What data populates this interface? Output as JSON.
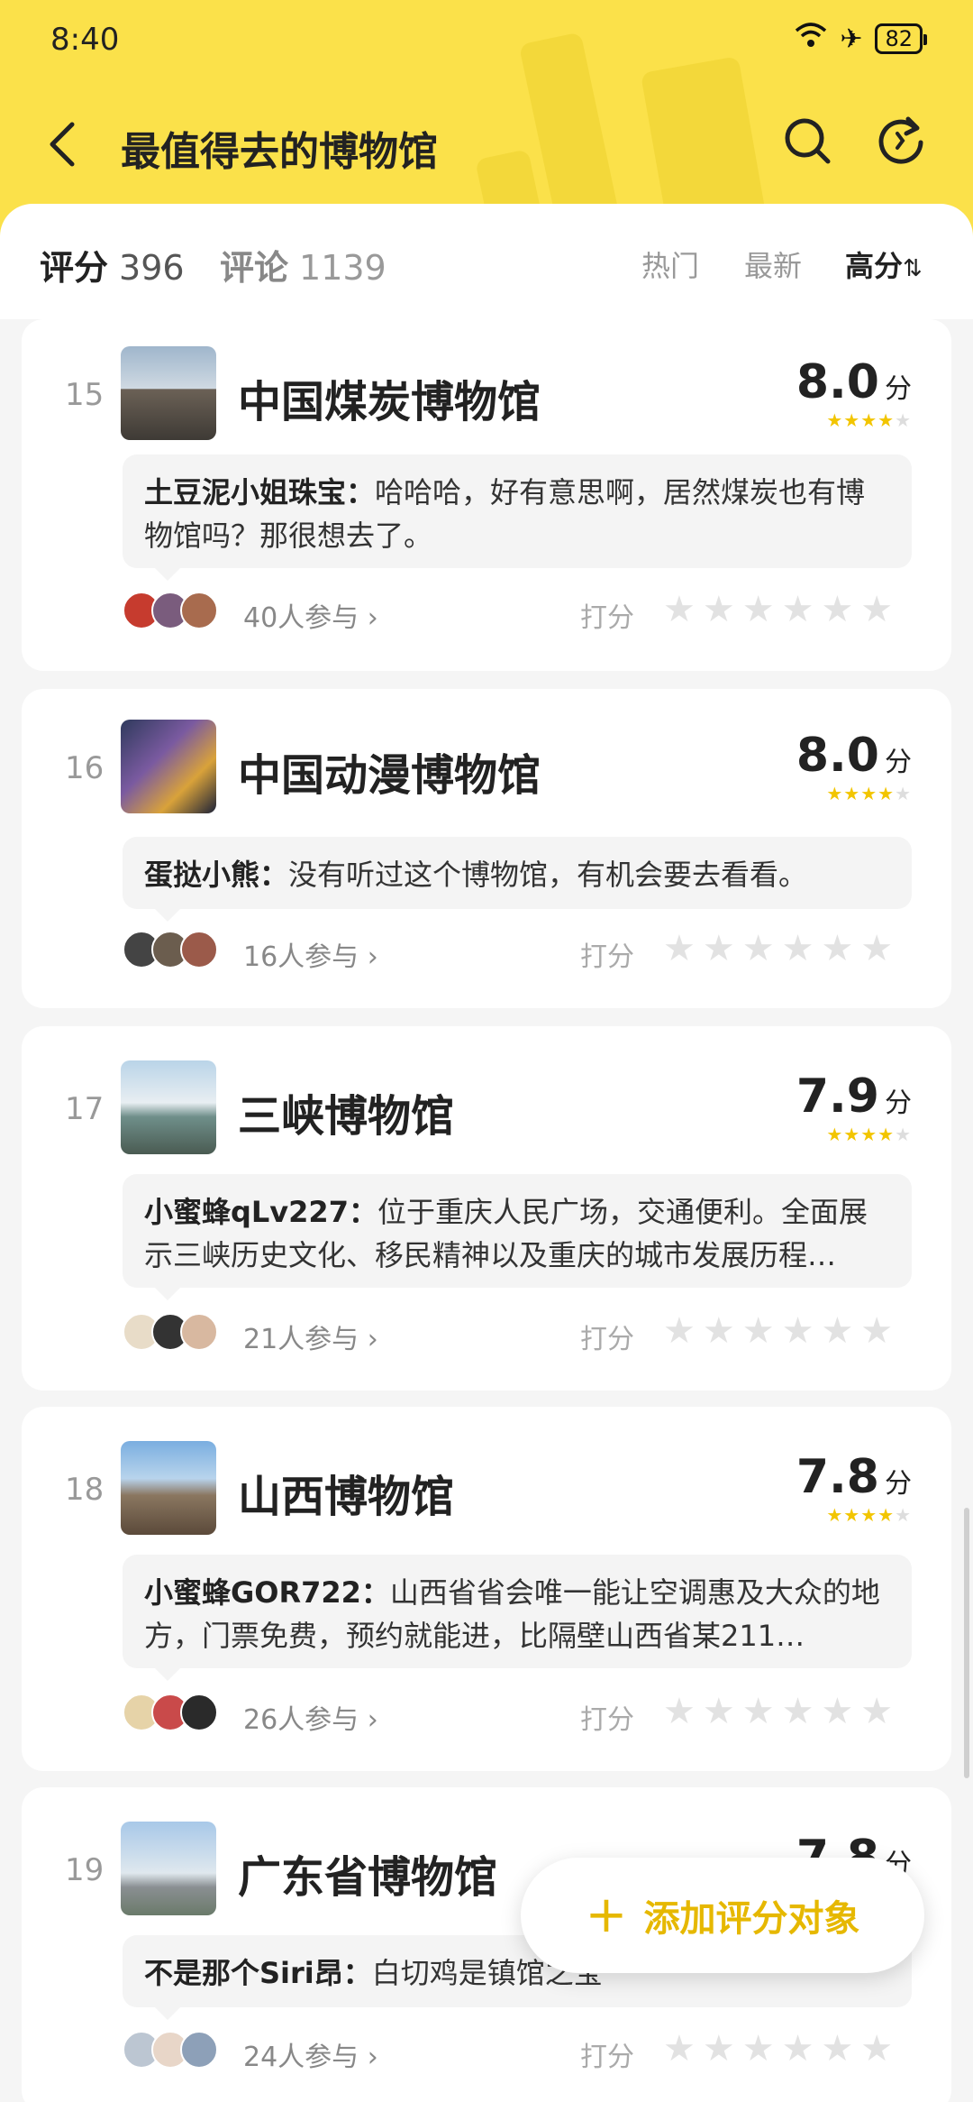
{
  "status_bar": {
    "time": "8:40",
    "battery": "82"
  },
  "header": {
    "title": "最值得去的博物馆"
  },
  "stats": {
    "score_label": "评分",
    "score_count": "396",
    "comment_label": "评论",
    "comment_count": "1139"
  },
  "sort": {
    "hot": "热门",
    "new": "最新",
    "high": "高分",
    "high_icon": "⇅"
  },
  "items": [
    {
      "rank": "15",
      "name": "中国煤炭博物馆",
      "score": "8.0",
      "unit": "分",
      "stars": 4,
      "commenter": "土豆泥小姐珠宝：",
      "comment": "哈哈哈，好有意思啊，居然煤炭也有博物馆吗？那很想去了。",
      "participants": "40人参与 ›",
      "rate_label": "打分"
    },
    {
      "rank": "16",
      "name": "中国动漫博物馆",
      "score": "8.0",
      "unit": "分",
      "stars": 4,
      "commenter": "蛋挞小熊：",
      "comment": "没有听过这个博物馆，有机会要去看看。",
      "participants": "16人参与 ›",
      "rate_label": "打分"
    },
    {
      "rank": "17",
      "name": "三峡博物馆",
      "score": "7.9",
      "unit": "分",
      "stars": 4,
      "commenter": "小蜜蜂qLv227：",
      "comment": "位于重庆人民广场，交通便利。全面展示三峡历史文化、移民精神以及重庆的城市发展历程…",
      "participants": "21人参与 ›",
      "rate_label": "打分"
    },
    {
      "rank": "18",
      "name": "山西博物馆",
      "score": "7.8",
      "unit": "分",
      "stars": 4,
      "commenter": "小蜜蜂GOR722：",
      "comment": "山西省省会唯一能让空调惠及大众的地方，门票免费，预约就能进，比隔壁山西省某211…",
      "participants": "26人参与 ›",
      "rate_label": "打分"
    },
    {
      "rank": "19",
      "name": "广东省博物馆",
      "score": "7.8",
      "unit": "分",
      "stars": 4,
      "commenter": "不是那个Siri昂：",
      "comment": "白切鸡是镇馆之宝",
      "participants": "24人参与 ›",
      "rate_label": "打分"
    }
  ],
  "fab": {
    "label": "添加评分对象",
    "icon": "+"
  },
  "colors": {
    "accent": "#fbe14a",
    "star": "#f2c500",
    "fab_text": "#e6b800"
  }
}
